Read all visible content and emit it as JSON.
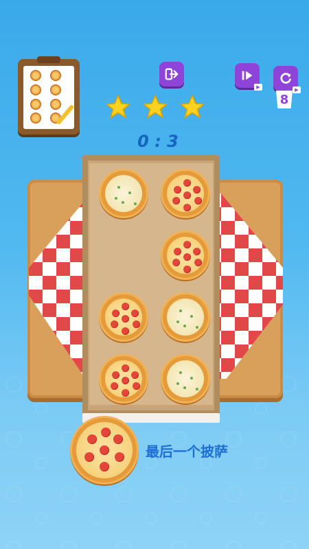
{
  "hud": {
    "score_text": "0 : 3",
    "retry_count": "8",
    "stars": 3
  },
  "buttons": {
    "exit_icon": "exit-icon",
    "skip_icon": "skip-icon",
    "retry_icon": "retry-icon"
  },
  "box": {
    "pizzas": [
      "white",
      "pepperoni",
      "empty",
      "pepperoni",
      "pepperoni",
      "white",
      "pepperoni",
      "white"
    ]
  },
  "next": {
    "label": "最后一个披萨",
    "pizza": "pepperoni"
  },
  "colors": {
    "accent_purple": "#8e44d9",
    "score_blue": "#1565c0",
    "star_gold": "#ffd21f"
  }
}
